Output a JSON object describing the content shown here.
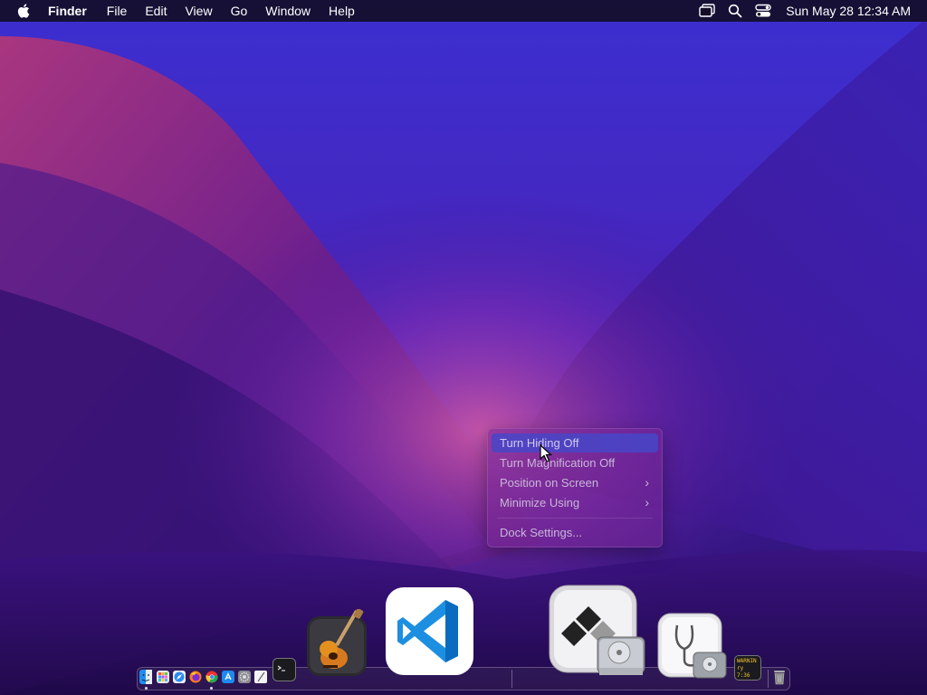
{
  "menubar": {
    "app_name": "Finder",
    "menus": [
      "File",
      "Edit",
      "View",
      "Go",
      "Window",
      "Help"
    ],
    "clock": "Sun May 28  12:34 AM"
  },
  "context_menu": {
    "items": [
      {
        "label": "Turn Hiding Off",
        "highlighted": true,
        "submenu": false
      },
      {
        "label": "Turn Magnification Off",
        "highlighted": false,
        "submenu": false
      },
      {
        "label": "Position on Screen",
        "highlighted": false,
        "submenu": true
      },
      {
        "label": "Minimize Using",
        "highlighted": false,
        "submenu": true
      },
      {
        "label": "Dock Settings...",
        "highlighted": false,
        "submenu": false
      }
    ],
    "chevron": "›"
  },
  "dock": {
    "apps": [
      "finder-icon",
      "launchpad-icon",
      "safari-icon",
      "firefox-icon",
      "chrome-icon",
      "app-store-icon",
      "system-settings-icon",
      "textedit-icon",
      "terminal-icon",
      "garageband-icon",
      "vscode-icon",
      "boot-camp-assistant-icon",
      "disk-utility-icon",
      "console-icon",
      "trash-icon"
    ],
    "console_text_line1": "WARNIN",
    "console_text_line2": "ry 7:36"
  },
  "colors": {
    "highlight": "#4646c8",
    "vscode_blue": "#0a7ad4"
  }
}
